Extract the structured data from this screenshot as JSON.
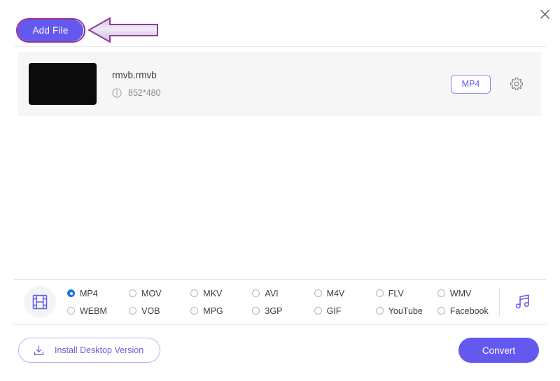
{
  "window": {
    "close_label": "×",
    "close_icon": "close-icon"
  },
  "header": {
    "add_file_label": "Add File",
    "annotation": {
      "type": "arrow-left",
      "target": "Add File",
      "outline_color": "#9c2f9c",
      "fill_color": "#ddd3e8"
    }
  },
  "colors": {
    "accent": "#6459ef",
    "accent_light": "#8e86f0",
    "radio_selected": "#1a73e8",
    "row_bg": "#f6f6f6",
    "annotation": "#9c2f9c"
  },
  "file_list": {
    "files": [
      {
        "name": "rmvb.rmvb",
        "resolution": "852*480",
        "info_icon": "info-icon",
        "format_chip": "MP4",
        "settings_icon": "gear-icon",
        "thumbnail_color": "#0b0b0b"
      }
    ]
  },
  "format_bar": {
    "media_type_icon": "film-strip-icon",
    "audio_icon": "music-note-icon",
    "options": [
      {
        "label": "MP4",
        "selected": true
      },
      {
        "label": "MOV",
        "selected": false
      },
      {
        "label": "MKV",
        "selected": false
      },
      {
        "label": "AVI",
        "selected": false
      },
      {
        "label": "M4V",
        "selected": false
      },
      {
        "label": "FLV",
        "selected": false
      },
      {
        "label": "WMV",
        "selected": false
      },
      {
        "label": "WEBM",
        "selected": false
      },
      {
        "label": "VOB",
        "selected": false
      },
      {
        "label": "MPG",
        "selected": false
      },
      {
        "label": "3GP",
        "selected": false
      },
      {
        "label": "GIF",
        "selected": false
      },
      {
        "label": "YouTube",
        "selected": false
      },
      {
        "label": "Facebook",
        "selected": false
      }
    ]
  },
  "action_bar": {
    "install_label": "Install Desktop Version",
    "install_icon": "download-icon",
    "convert_label": "Convert"
  }
}
